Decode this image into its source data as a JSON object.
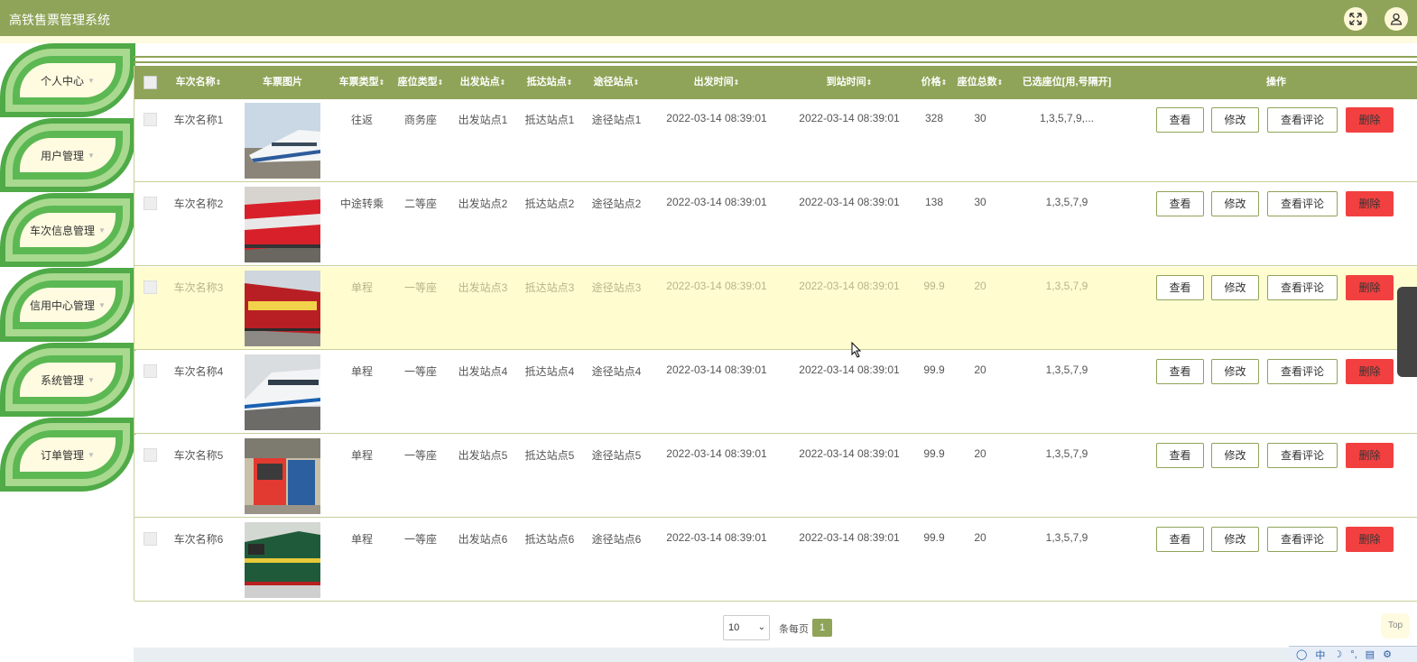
{
  "app": {
    "title": "高铁售票管理系统"
  },
  "sidebar": {
    "items": [
      {
        "label": "个人中心"
      },
      {
        "label": "用户管理"
      },
      {
        "label": "车次信息管理"
      },
      {
        "label": "信用中心管理"
      },
      {
        "label": "系统管理"
      },
      {
        "label": "订单管理"
      }
    ]
  },
  "table": {
    "headers": {
      "name": "车次名称",
      "image": "车票图片",
      "ticket_type": "车票类型",
      "seat_type": "座位类型",
      "depart": "出发站点",
      "arrive": "抵达站点",
      "via": "途径站点",
      "depart_time": "出发时间",
      "arrive_time": "到站时间",
      "price": "价格",
      "seats_total": "座位总数",
      "selected_seats": "已选座位[用,号隔开]",
      "actions": "操作"
    },
    "actions": {
      "view": "查看",
      "edit": "修改",
      "review": "查看评论",
      "delete": "删除"
    },
    "rows": [
      {
        "name": "车次名称1",
        "ticket_type": "往返",
        "seat_type": "商务座",
        "depart": "出发站点1",
        "arrive": "抵达站点1",
        "via": "途径站点1",
        "depart_time": "2022-03-14 08:39:01",
        "arrive_time": "2022-03-14 08:39:01",
        "price": "328",
        "seats_total": "30",
        "selected_seats": "1,3,5,7,9,..."
      },
      {
        "name": "车次名称2",
        "ticket_type": "中途转乘",
        "seat_type": "二等座",
        "depart": "出发站点2",
        "arrive": "抵达站点2",
        "via": "途径站点2",
        "depart_time": "2022-03-14 08:39:01",
        "arrive_time": "2022-03-14 08:39:01",
        "price": "138",
        "seats_total": "30",
        "selected_seats": "1,3,5,7,9"
      },
      {
        "name": "车次名称3",
        "ticket_type": "单程",
        "seat_type": "一等座",
        "depart": "出发站点3",
        "arrive": "抵达站点3",
        "via": "途径站点3",
        "depart_time": "2022-03-14 08:39:01",
        "arrive_time": "2022-03-14 08:39:01",
        "price": "99.9",
        "seats_total": "20",
        "selected_seats": "1,3,5,7,9"
      },
      {
        "name": "车次名称4",
        "ticket_type": "单程",
        "seat_type": "一等座",
        "depart": "出发站点4",
        "arrive": "抵达站点4",
        "via": "途径站点4",
        "depart_time": "2022-03-14 08:39:01",
        "arrive_time": "2022-03-14 08:39:01",
        "price": "99.9",
        "seats_total": "20",
        "selected_seats": "1,3,5,7,9"
      },
      {
        "name": "车次名称5",
        "ticket_type": "单程",
        "seat_type": "一等座",
        "depart": "出发站点5",
        "arrive": "抵达站点5",
        "via": "途径站点5",
        "depart_time": "2022-03-14 08:39:01",
        "arrive_time": "2022-03-14 08:39:01",
        "price": "99.9",
        "seats_total": "20",
        "selected_seats": "1,3,5,7,9"
      },
      {
        "name": "车次名称6",
        "ticket_type": "单程",
        "seat_type": "一等座",
        "depart": "出发站点6",
        "arrive": "抵达站点6",
        "via": "途径站点6",
        "depart_time": "2022-03-14 08:39:01",
        "arrive_time": "2022-03-14 08:39:01",
        "price": "99.9",
        "seats_total": "20",
        "selected_seats": "1,3,5,7,9"
      }
    ]
  },
  "pagination": {
    "page_size": "10",
    "per_page_label": "条每页",
    "current_page": "1"
  },
  "back_to_top": "Top",
  "ime": {
    "lang": "中"
  },
  "colors": {
    "primary": "#8fa458",
    "delete": "#f24040",
    "highlight_row": "#fffdd0",
    "menu_green": "#4faa47"
  }
}
